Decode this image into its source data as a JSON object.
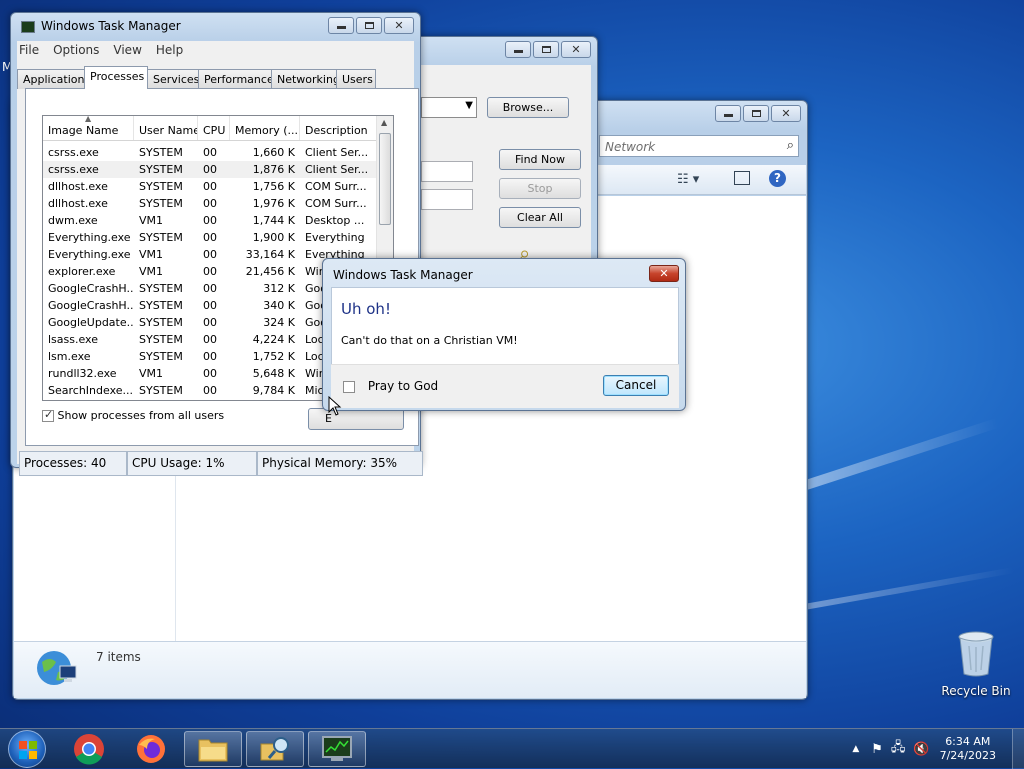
{
  "desktop": {
    "recycle_bin_label": "Recycle Bin",
    "edge_letter": "M"
  },
  "explorer": {
    "search_placeholder": "Network",
    "status_count": "7 items"
  },
  "search_window": {
    "browse_label": "Browse...",
    "find_now_label": "Find Now",
    "stop_label": "Stop",
    "clear_all_label": "Clear All"
  },
  "task_manager": {
    "title": "Windows Task Manager",
    "menu": [
      "File",
      "Options",
      "View",
      "Help"
    ],
    "tabs": [
      "Applications",
      "Processes",
      "Services",
      "Performance",
      "Networking",
      "Users"
    ],
    "active_tab": "Processes",
    "columns": [
      "Image Name",
      "User Name",
      "CPU",
      "Memory (...",
      "Description"
    ],
    "rows": [
      [
        "csrss.exe",
        "SYSTEM",
        "00",
        "1,660 K",
        "Client Ser..."
      ],
      [
        "csrss.exe",
        "SYSTEM",
        "00",
        "1,876 K",
        "Client Ser..."
      ],
      [
        "dllhost.exe",
        "SYSTEM",
        "00",
        "1,756 K",
        "COM Surr..."
      ],
      [
        "dllhost.exe",
        "SYSTEM",
        "00",
        "1,976 K",
        "COM Surr..."
      ],
      [
        "dwm.exe",
        "VM1",
        "00",
        "1,744 K",
        "Desktop ..."
      ],
      [
        "Everything.exe",
        "SYSTEM",
        "00",
        "1,900 K",
        "Everything"
      ],
      [
        "Everything.exe",
        "VM1",
        "00",
        "33,164 K",
        "Everything"
      ],
      [
        "explorer.exe",
        "VM1",
        "00",
        "21,456 K",
        "Windows ..."
      ],
      [
        "GoogleCrashH...",
        "SYSTEM",
        "00",
        "312 K",
        "Goo..."
      ],
      [
        "GoogleCrashH...",
        "SYSTEM",
        "00",
        "340 K",
        "Goo..."
      ],
      [
        "GoogleUpdate....",
        "SYSTEM",
        "00",
        "324 K",
        "Goo..."
      ],
      [
        "lsass.exe",
        "SYSTEM",
        "00",
        "4,224 K",
        "Loc..."
      ],
      [
        "lsm.exe",
        "SYSTEM",
        "00",
        "1,752 K",
        "Loc..."
      ],
      [
        "rundll32.exe",
        "VM1",
        "00",
        "5,648 K",
        "Win..."
      ],
      [
        "SearchIndexe...",
        "SYSTEM",
        "00",
        "9,784 K",
        "Mic..."
      ]
    ],
    "show_all_label": "Show processes from all users",
    "end_process_partial": "E",
    "status": {
      "processes": "Processes: 40",
      "cpu": "CPU Usage: 1%",
      "memory": "Physical Memory: 35%"
    }
  },
  "dialog": {
    "title": "Windows Task Manager",
    "heading": "Uh oh!",
    "message": "Can't do that on a Christian VM!",
    "checkbox_label": "Pray to God",
    "cancel_label": "Cancel",
    "heading_color": "#1e3287"
  },
  "clock": {
    "time": "6:34 AM",
    "date": "7/24/2023"
  }
}
